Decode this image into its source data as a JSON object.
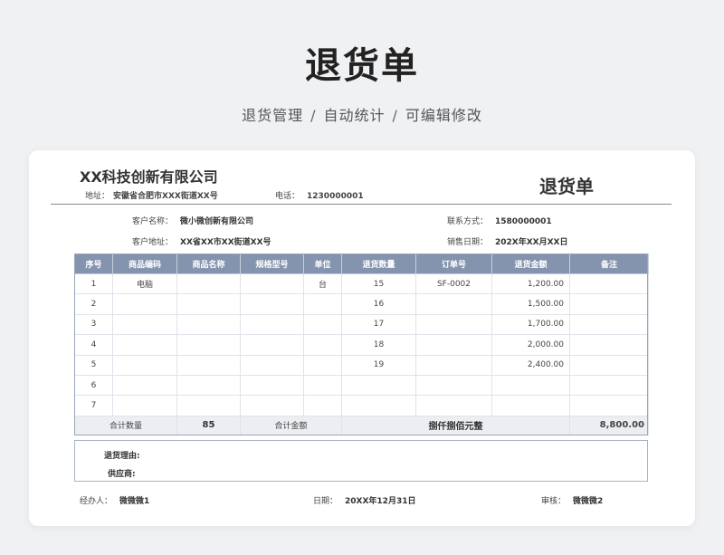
{
  "hero": {
    "title": "退货单",
    "sub": [
      "退货管理",
      "自动统计",
      "可编辑修改"
    ],
    "sep": "/"
  },
  "company": {
    "name": "XX科技创新有限公司",
    "address_label": "地址：",
    "address": "安徽省合肥市XXX街道XX号",
    "phone_label": "电话：",
    "phone": "1230000001",
    "doc_title": "退货单"
  },
  "customer": {
    "name_label": "客户名称：",
    "name": "微小微创新有限公司",
    "contact_label": "联系方式：",
    "contact": "1580000001",
    "address_label": "客户地址：",
    "address": "XX省XX市XX街道XX号",
    "sale_date_label": "销售日期：",
    "sale_date": "202X年XX月XX日"
  },
  "table": {
    "headers": [
      "序号",
      "商品编码",
      "商品名称",
      "规格型号",
      "单位",
      "退货数量",
      "订单号",
      "退货金额",
      "备注"
    ],
    "rows": [
      [
        "1",
        "电脑",
        "",
        "",
        "台",
        "15",
        "SF-0002",
        "1,200.00",
        ""
      ],
      [
        "2",
        "",
        "",
        "",
        "",
        "16",
        "",
        "1,500.00",
        ""
      ],
      [
        "3",
        "",
        "",
        "",
        "",
        "17",
        "",
        "1,700.00",
        ""
      ],
      [
        "4",
        "",
        "",
        "",
        "",
        "18",
        "",
        "2,000.00",
        ""
      ],
      [
        "5",
        "",
        "",
        "",
        "",
        "19",
        "",
        "2,400.00",
        ""
      ],
      [
        "6",
        "",
        "",
        "",
        "",
        "",
        "",
        "",
        ""
      ],
      [
        "7",
        "",
        "",
        "",
        "",
        "",
        "",
        "",
        ""
      ]
    ],
    "total": {
      "qty_label": "合计数量",
      "qty": "85",
      "amount_label": "合计金额",
      "amount_words": "捌仟捌佰元整",
      "amount": "8,800.00"
    }
  },
  "reason": {
    "reason_label": "退货理由:",
    "supplier_label": "供应商:"
  },
  "footer": {
    "handler_label": "经办人：",
    "handler": "微微微1",
    "date_label": "日期：",
    "date": "20XX年12月31日",
    "review_label": "审核：",
    "reviewer": "微微微2"
  }
}
